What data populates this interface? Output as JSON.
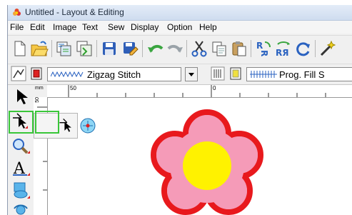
{
  "window": {
    "title": "Untitled - Layout & Editing"
  },
  "menu": [
    "File",
    "Edit",
    "Image",
    "Text",
    "Sew",
    "Display",
    "Option",
    "Help"
  ],
  "toolbar2": {
    "line_stitch": "Zigzag Stitch",
    "fill_stitch": "Prog. Fill S"
  },
  "ruler": {
    "unit": "mm",
    "top_labels": [
      "50",
      "0"
    ],
    "left_label": "50"
  },
  "colors": {
    "petal_outline": "#e8191d",
    "petal_fill": "#f59bb8",
    "center": "#fff200",
    "highlight": "#39c639"
  },
  "icons": {
    "toolbar": [
      "new-file-icon",
      "open-file-icon",
      "import-icon",
      "import-alt-icon",
      "save-icon",
      "save-as-icon",
      "undo-icon",
      "redo-icon",
      "cut-icon",
      "copy-icon",
      "paste-icon",
      "rotate-icon",
      "mirror-icon",
      "rotate-arrow-icon",
      "wizard-icon"
    ],
    "left": [
      "select-icon",
      "point-edit-icon",
      "zoom-icon",
      "text-icon",
      "shape-icon"
    ]
  }
}
